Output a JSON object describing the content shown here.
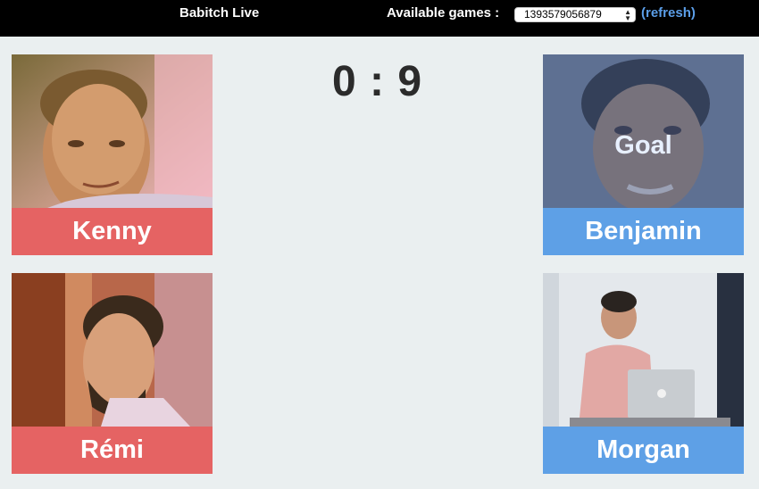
{
  "header": {
    "title": "Babitch Live",
    "games_label": "Available games :",
    "selected_game": "1393579056879",
    "refresh_label": "(refresh)"
  },
  "score": {
    "text": "0 : 9"
  },
  "players": {
    "top_left": {
      "name": "Kenny",
      "team_color": "#e56363"
    },
    "bottom_left": {
      "name": "Rémi",
      "team_color": "#e56363"
    },
    "top_right": {
      "name": "Benjamin",
      "team_color": "#5ea0e6",
      "overlay_label": "Goal"
    },
    "bottom_right": {
      "name": "Morgan",
      "team_color": "#5ea0e6"
    }
  }
}
